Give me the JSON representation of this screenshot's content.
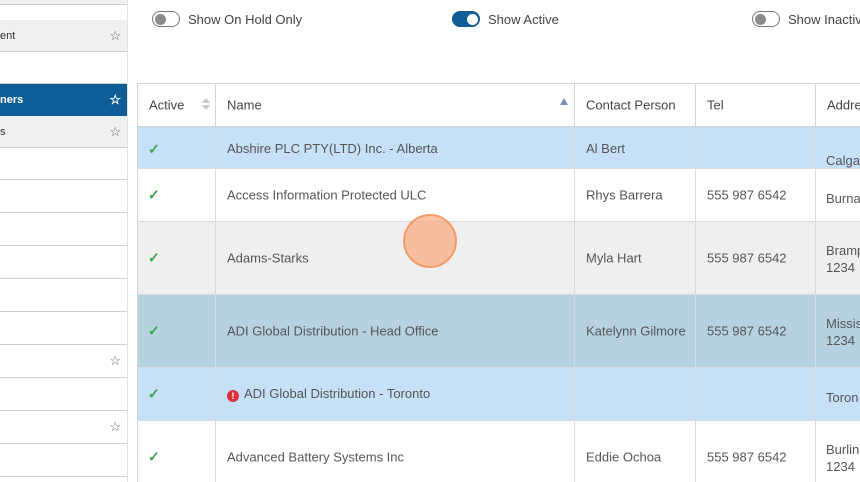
{
  "sidebar": {
    "items": [
      {
        "label": "",
        "star": true
      },
      {
        "label": "ent",
        "star": true
      },
      {
        "label": "",
        "star": false
      },
      {
        "label": "ners",
        "star": true,
        "active": true
      },
      {
        "label": "s",
        "star": true
      },
      {
        "label": "",
        "star": false
      },
      {
        "label": "",
        "star": false
      },
      {
        "label": "",
        "star": false
      },
      {
        "label": "",
        "star": false
      },
      {
        "label": "",
        "star": false
      },
      {
        "label": "",
        "star": false
      },
      {
        "label": "",
        "star": true
      },
      {
        "label": "",
        "star": false
      },
      {
        "label": "",
        "star": true
      },
      {
        "label": "",
        "star": false
      }
    ],
    "star_glyph": "☆"
  },
  "filters": {
    "on_hold": {
      "label": "Show On Hold Only",
      "checked": false
    },
    "active": {
      "label": "Show Active",
      "checked": true
    },
    "inactive": {
      "label": "Show Inactiv",
      "checked": false
    }
  },
  "grid": {
    "columns": {
      "active": "Active",
      "name": "Name",
      "contact": "Contact Person",
      "tel": "Tel",
      "address": "Addre"
    },
    "check_glyph": "✓",
    "alert_glyph": "!",
    "rows": [
      {
        "name": "Abshire PLC PTY(LTD) Inc. - Alberta",
        "contact": "Al Bert",
        "tel": "",
        "addr1": "Calgar",
        "addr2": "",
        "alert": false
      },
      {
        "name": "Access Information Protected ULC",
        "contact": "Rhys Barrera",
        "tel": "555 987 6542",
        "addr1": "Burna",
        "addr2": "",
        "alert": false
      },
      {
        "name": "Adams-Starks",
        "contact": "Myla Hart",
        "tel": "555 987 6542",
        "addr1": "Bramp",
        "addr2": "1234",
        "alert": false
      },
      {
        "name": "ADI Global Distribution - Head Office",
        "contact": "Katelynn Gilmore",
        "tel": "555 987 6542",
        "addr1": "Missis",
        "addr2": "1234",
        "alert": false
      },
      {
        "name": "ADI Global Distribution - Toronto",
        "contact": "",
        "tel": "",
        "addr1": "Toron",
        "addr2": "",
        "alert": true
      },
      {
        "name": "Advanced Battery Systems Inc",
        "contact": "Eddie Ochoa",
        "tel": "555 987 6542",
        "addr1": "Burling",
        "addr2": "1234",
        "alert": false
      }
    ]
  },
  "colors": {
    "accent": "#0f5d97",
    "row_selected": "#c6e0f7",
    "row_hover": "#efefef",
    "row_highlight": "#b6d2e1",
    "check": "#3aa34a",
    "alert": "#d9323a"
  }
}
